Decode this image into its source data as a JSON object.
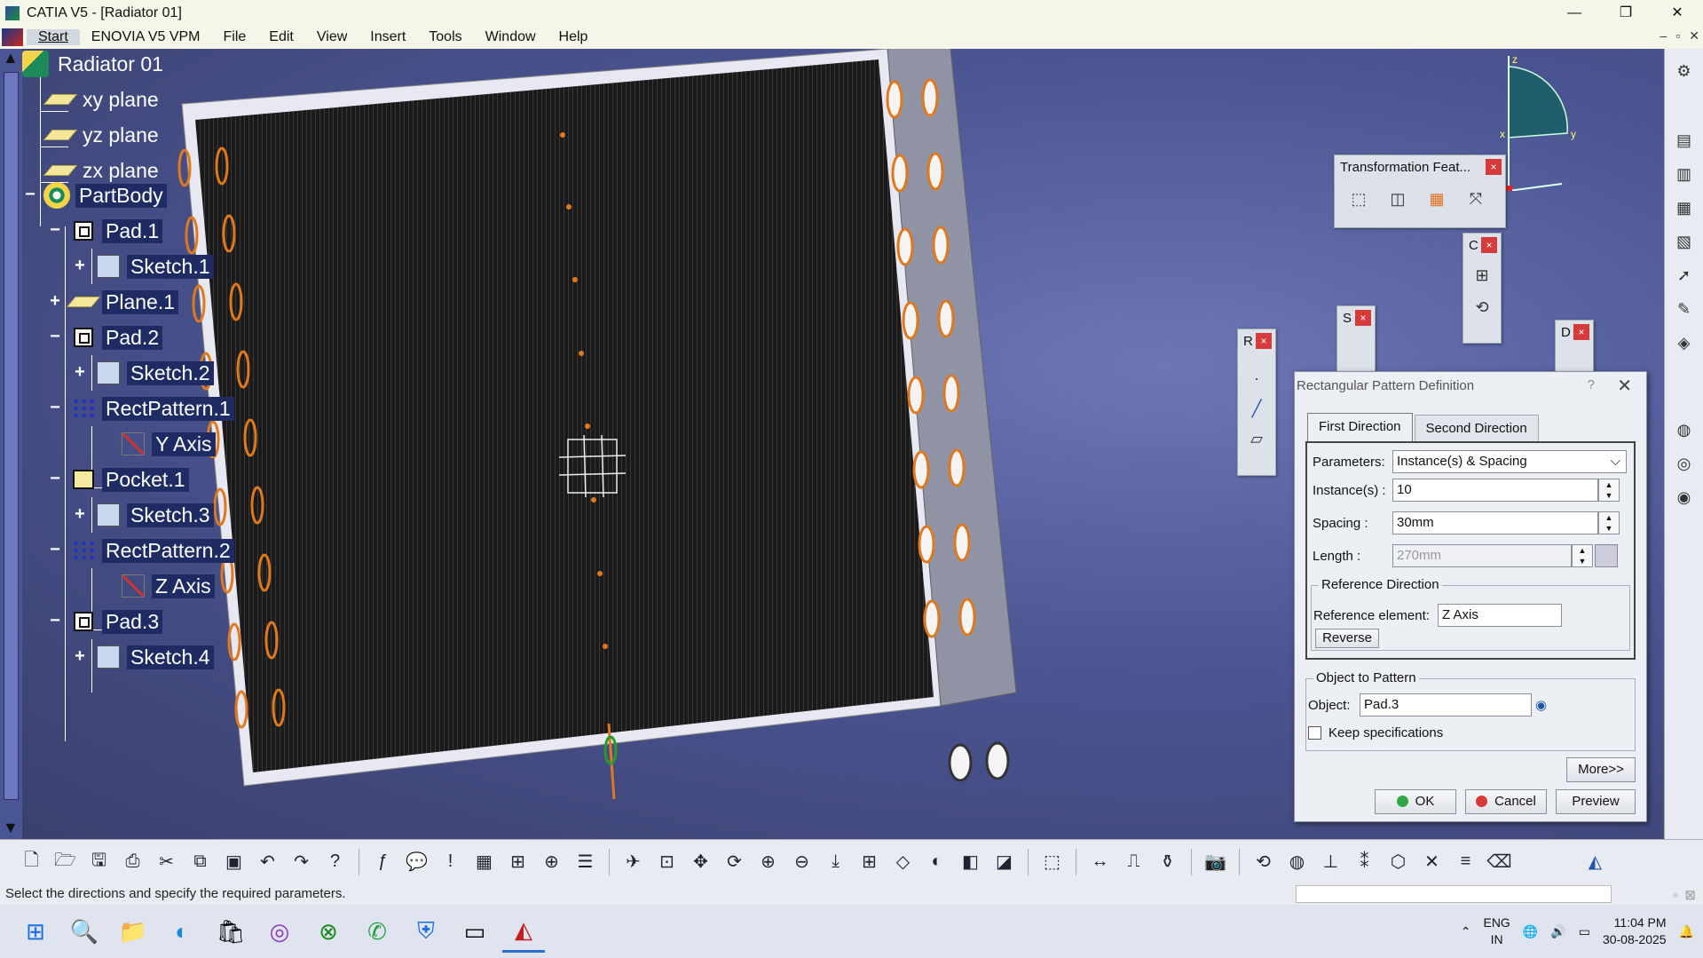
{
  "window": {
    "title": "CATIA V5 - [Radiator 01]",
    "controls": [
      "—",
      "❐",
      "✕"
    ]
  },
  "menu": {
    "items": [
      "Start",
      "ENOVIA V5 VPM",
      "File",
      "Edit",
      "View",
      "Insert",
      "Tools",
      "Window",
      "Help"
    ],
    "mdi_controls": [
      "–",
      "▫",
      "✕"
    ]
  },
  "tree": {
    "root": "Radiator 01",
    "nodes": [
      {
        "label": "xy plane"
      },
      {
        "label": "yz plane"
      },
      {
        "label": "zx plane"
      },
      {
        "label": "PartBody"
      },
      {
        "label": "Pad.1"
      },
      {
        "label": "Sketch.1"
      },
      {
        "label": "Plane.1"
      },
      {
        "label": "Pad.2"
      },
      {
        "label": "Sketch.2"
      },
      {
        "label": "RectPattern.1"
      },
      {
        "label": "Y Axis"
      },
      {
        "label": "Pocket.1"
      },
      {
        "label": "Sketch.3"
      },
      {
        "label": "RectPattern.2"
      },
      {
        "label": "Z Axis"
      },
      {
        "label": "Pad.3"
      },
      {
        "label": "Sketch.4"
      }
    ]
  },
  "compass": {
    "z": "z",
    "x": "x",
    "y": "y"
  },
  "floating_toolbars": {
    "transformation": {
      "title": "Transformation Feat..."
    },
    "c": {
      "title": "C"
    },
    "s": {
      "title": "S"
    },
    "d": {
      "title": "D"
    },
    "r": {
      "title": "R"
    },
    "close": "×"
  },
  "dialog": {
    "title": "Rectangular Pattern Definition",
    "help": "?",
    "close": "✕",
    "tabs": [
      "First Direction",
      "Second Direction"
    ],
    "parameters_label": "Parameters:",
    "parameters_value": "Instance(s) & Spacing",
    "instances_label": "Instance(s) :",
    "instances_value": "10",
    "spacing_label": "Spacing :",
    "spacing_value": "30mm",
    "length_label": "Length :",
    "length_value": "270mm",
    "reference_group": "Reference Direction",
    "reference_element_label": "Reference element:",
    "reference_element_value": "Z Axis",
    "reverse_button": "Reverse",
    "object_group": "Object to Pattern",
    "object_label": "Object:",
    "object_value": "Pad.3",
    "keep_specifications": "Keep specifications",
    "keep_specifications_checked": false,
    "more_button": "More>>",
    "ok_button": "OK",
    "cancel_button": "Cancel",
    "preview_button": "Preview"
  },
  "status": {
    "message": "Select the directions and specify the required parameters."
  },
  "taskbar": {
    "lang_line1": "ENG",
    "lang_line2": "IN",
    "time": "11:04 PM",
    "date": "30-08-2025"
  },
  "colors": {
    "viewport_bg": "#4b5592",
    "accent_orange": "#e0781e",
    "dialog_bg": "#eceff4"
  }
}
